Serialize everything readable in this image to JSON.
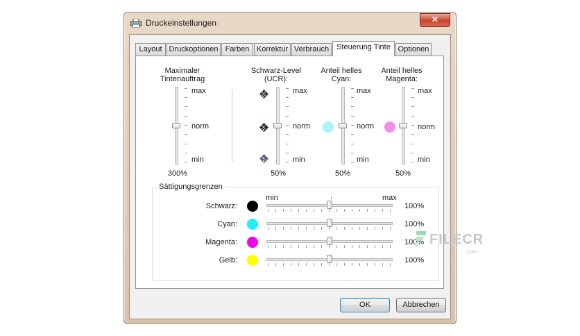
{
  "window": {
    "title": "Druckeinstellungen",
    "close_glyph": "✕"
  },
  "tabs": [
    {
      "label": "Layout",
      "active": false
    },
    {
      "label": "Druckoptionen",
      "active": false
    },
    {
      "label": "Farben",
      "active": false
    },
    {
      "label": "Korrektur",
      "active": false
    },
    {
      "label": "Verbrauch",
      "active": false
    },
    {
      "label": "Steuerung Tinte",
      "active": true
    },
    {
      "label": "Optionen",
      "active": false
    }
  ],
  "ink_sliders": [
    {
      "title_line1": "Maximaler",
      "title_line2": "Tintenauftrag",
      "max": "max",
      "norm": "norm",
      "min": "min",
      "value": "300%",
      "level": 0.5
    },
    {
      "title_line1": "Schwarz-Level",
      "title_line2": "(UCR):",
      "max": "max",
      "norm": "norm",
      "min": "min",
      "value": "50%",
      "level": 0.5
    },
    {
      "title_line1": "Anteil helles",
      "title_line2": "Cyan:",
      "max": "max",
      "norm": "norm",
      "min": "min",
      "value": "50%",
      "level": 0.5,
      "color": "#a8f4f8"
    },
    {
      "title_line1": "Anteil helles",
      "title_line2": "Magenta:",
      "max": "max",
      "norm": "norm",
      "min": "min",
      "value": "50%",
      "level": 0.5,
      "color": "#f28ee8"
    }
  ],
  "saturation": {
    "group_title": "Sättigungsgrenzen",
    "scale_min": "min",
    "scale_max": "max",
    "rows": [
      {
        "label": "Schwarz:",
        "value": "100%",
        "color": "#000000",
        "level": 0.5
      },
      {
        "label": "Cyan:",
        "value": "100%",
        "color": "#22f0f8",
        "level": 0.5
      },
      {
        "label": "Magenta:",
        "value": "100%",
        "color": "#f000f0",
        "level": 0.5
      },
      {
        "label": "Gelb:",
        "value": "100%",
        "color": "#ffff00",
        "level": 0.5
      }
    ]
  },
  "buttons": {
    "ok": "OK",
    "cancel": "Abbrechen"
  },
  "watermark": {
    "text": "FILECR",
    "sub": ".com"
  },
  "icons": {
    "title": "printer-icon",
    "ucr_high": "checker-dark-icon",
    "ucr_mid": "checker-color-icon",
    "ucr_low": "checker-color-light-icon"
  }
}
